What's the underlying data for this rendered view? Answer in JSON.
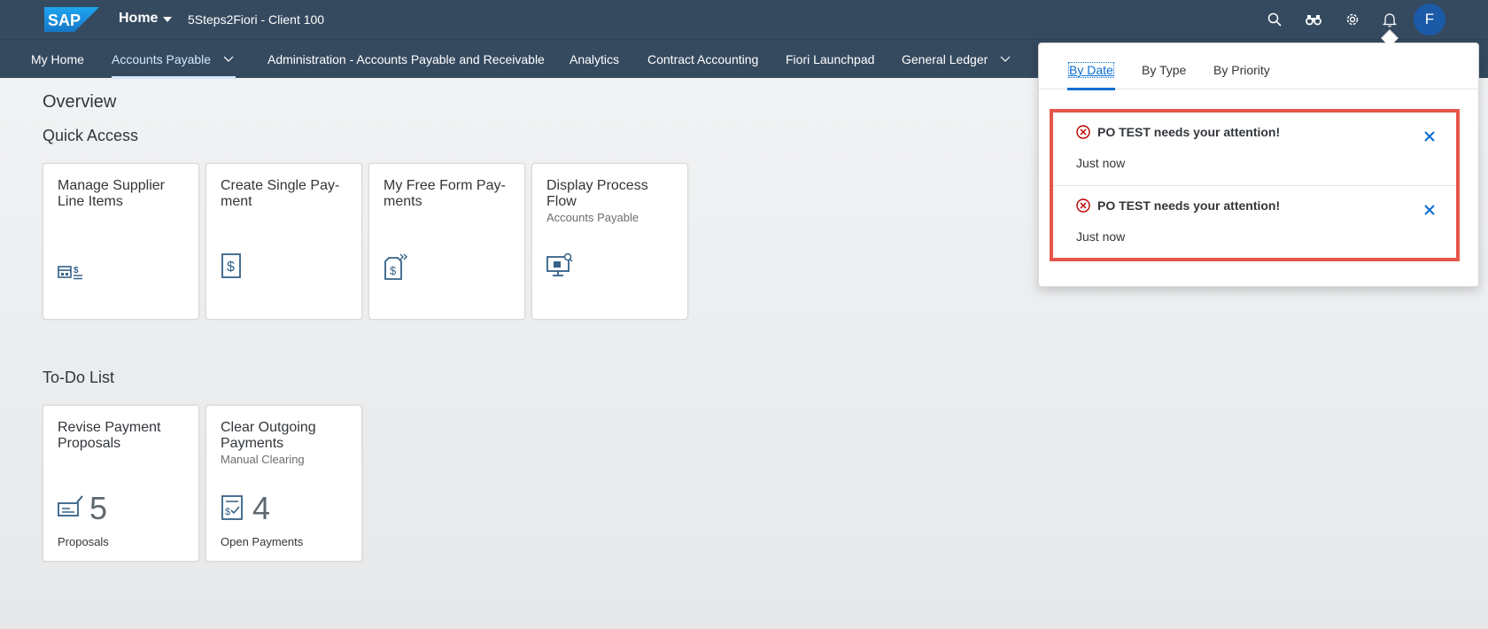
{
  "shell": {
    "logo_text": "SAP",
    "home_label": "Home",
    "client_label": "5Steps2Fiori - Client 100",
    "avatar_initial": "F",
    "icons": [
      "search-icon",
      "binoculars-icon",
      "gear-icon",
      "bell-icon"
    ]
  },
  "nav": {
    "items": [
      {
        "label": "My Home"
      },
      {
        "label": "Accounts Payable",
        "active": true,
        "has_menu": true
      },
      {
        "label": "Administration - Accounts Payable and Receivable"
      },
      {
        "label": "Analytics"
      },
      {
        "label": "Contract Accounting"
      },
      {
        "label": "Fiori Launchpad"
      },
      {
        "label": "General Ledger",
        "has_menu": true
      }
    ]
  },
  "page": {
    "overview": "Overview",
    "quick_access": "Quick Access",
    "todo": "To-Do List"
  },
  "quick_tiles": [
    {
      "title": "Manage Supplier Line Items",
      "subtitle": "",
      "icon": "supplier-payment-icon"
    },
    {
      "title": "Create Single Pay­ment",
      "subtitle": "",
      "icon": "dollar-document-icon"
    },
    {
      "title": "My Free Form Pay­ments",
      "subtitle": "",
      "icon": "dollar-form-icon"
    },
    {
      "title": "Display Process Flow",
      "subtitle": "Accounts Payable",
      "icon": "process-monitor-icon"
    }
  ],
  "todo_tiles": [
    {
      "title": "Revise Payment Proposals",
      "subtitle": "",
      "number": "5",
      "footer": "Proposals",
      "icon": "check-edit-icon"
    },
    {
      "title": "Clear Outgoing Payments",
      "subtitle": "Manual Clearing",
      "number": "4",
      "footer": "Open Payments",
      "icon": "dollar-checklist-icon"
    }
  ],
  "notifications": {
    "tabs": [
      {
        "label": "By Date",
        "active": true
      },
      {
        "label": "By Type"
      },
      {
        "label": "By Priority"
      }
    ],
    "items": [
      {
        "title": "PO TEST needs your attention!",
        "time": "Just now",
        "status_icon": "error-circle-icon"
      },
      {
        "title": "PO TEST needs your attention!",
        "time": "Just now",
        "status_icon": "error-circle-icon"
      }
    ]
  },
  "colors": {
    "shell": "#354a5f",
    "accent": "#0a6ed1",
    "highlight_border": "#e5554b",
    "error": "#bb0000",
    "avatar": "#1b5aa7"
  }
}
